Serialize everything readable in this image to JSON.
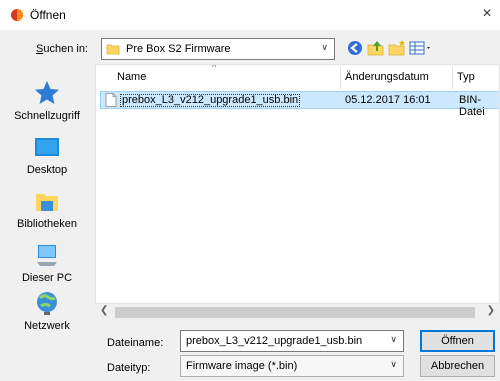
{
  "window": {
    "title": "Öffnen",
    "close_label": "×"
  },
  "toolbar": {
    "look_in_label": "Suchen in:",
    "look_in_value": "Pre Box S2 Firmware"
  },
  "places": [
    {
      "label": "Schnellzugriff",
      "icon": "star-icon"
    },
    {
      "label": "Desktop",
      "icon": "desktop-icon"
    },
    {
      "label": "Bibliotheken",
      "icon": "libraries-icon"
    },
    {
      "label": "Dieser PC",
      "icon": "computer-icon"
    },
    {
      "label": "Netzwerk",
      "icon": "network-icon"
    }
  ],
  "list": {
    "columns": [
      "Name",
      "Änderungsdatum",
      "Typ"
    ],
    "rows": [
      {
        "name": "prebox_L3_v212_upgrade1_usb.bin",
        "date": "05.12.2017 16:01",
        "type": "BIN-Datei"
      }
    ]
  },
  "footer": {
    "filename_label": "Dateiname:",
    "filename_value": "prebox_L3_v212_upgrade1_usb.bin",
    "filetype_label": "Dateityp:",
    "filetype_value": "Firmware image (*.bin)",
    "open_label": "Öffnen",
    "cancel_label": "Abbrechen"
  },
  "colors": {
    "selection": "#cce8ff",
    "accent": "#0078d7",
    "folder": "#ffd45f"
  }
}
